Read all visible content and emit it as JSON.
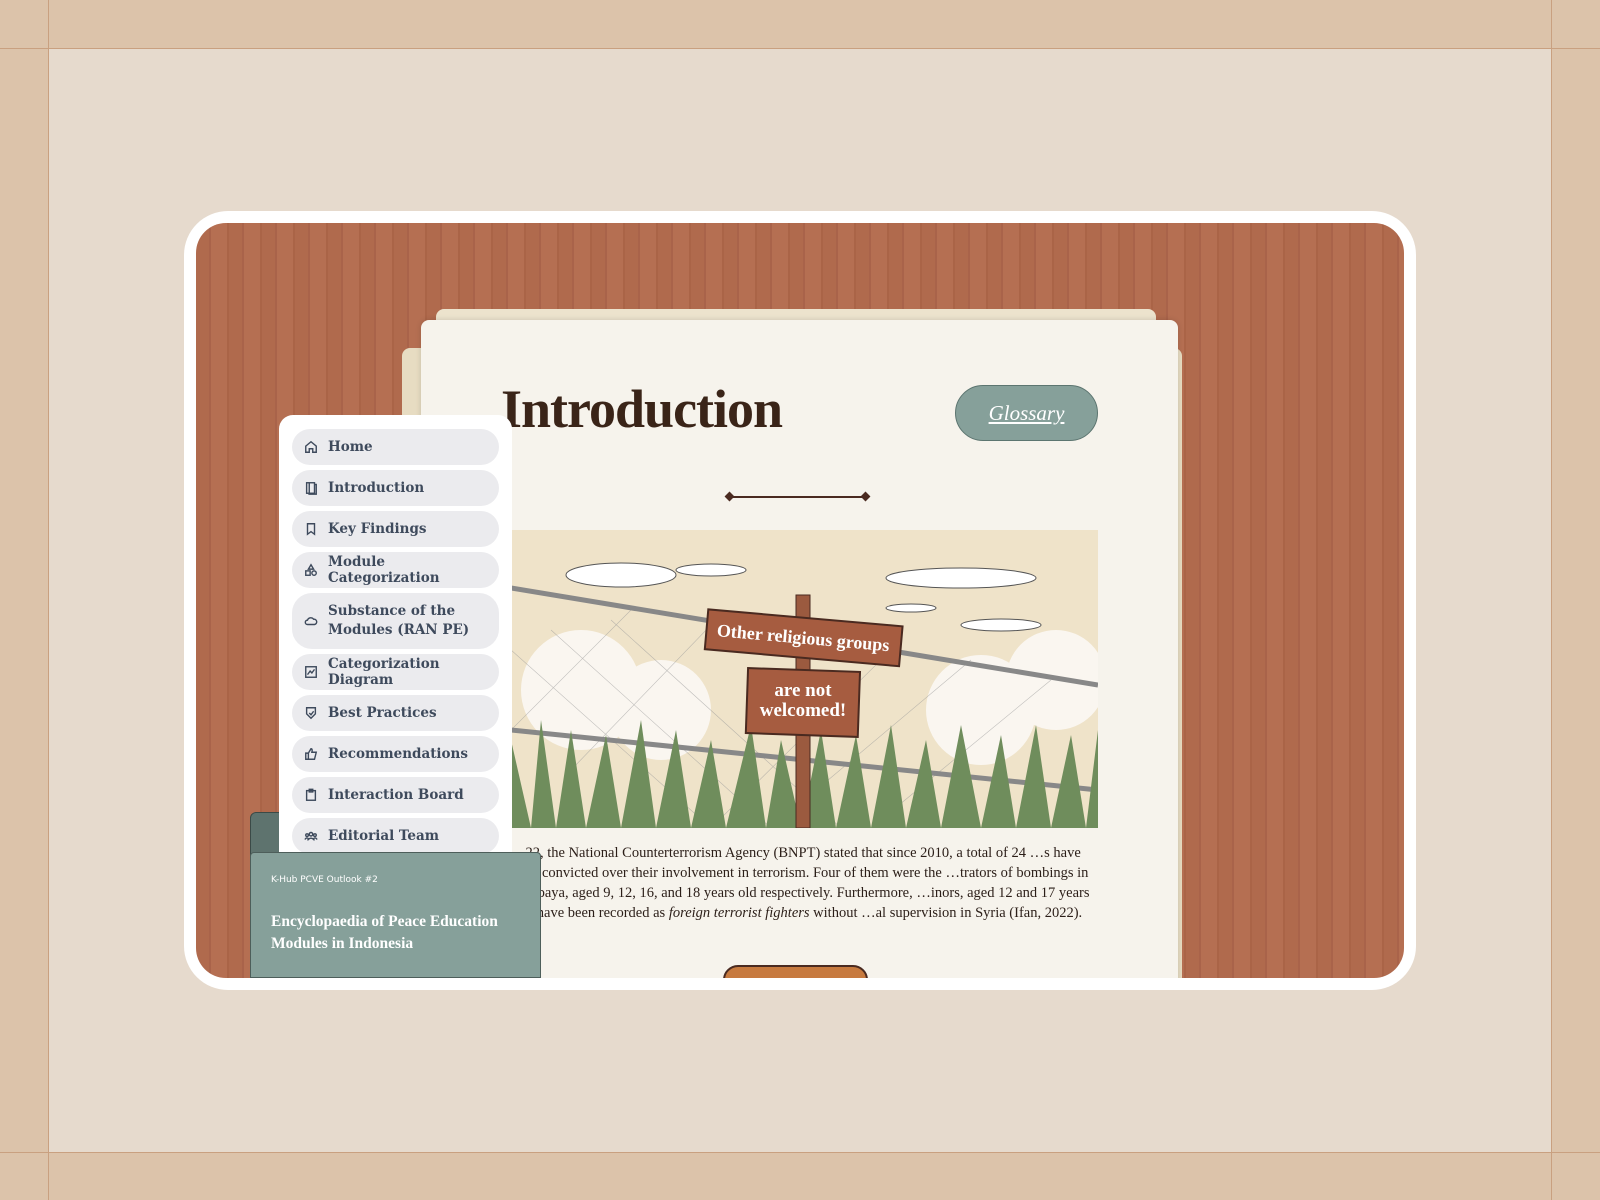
{
  "page": {
    "title": "Introduction",
    "glossary_label": "Glossary"
  },
  "illustration": {
    "sign_top": "Other religious groups",
    "sign_bottom_1": "are not",
    "sign_bottom_2": "welcomed!"
  },
  "paragraph": {
    "part1": "…22, the National Counterterrorism Agency (BNPT) stated that since 2010, a total of 24 …s have been convicted over their involvement in terrorism. Four of them were the …trators of bombings in Surabaya, aged 9, 12, 16, and 18 years old respectively. Furthermore, …inors, aged 12 and 17 years old, have been recorded as ",
    "italic": "foreign terrorist fighters",
    "part2": " without …al supervision in Syria (Ifan, 2022)."
  },
  "sidebar": {
    "items": [
      {
        "label": "Home",
        "icon": "home-icon"
      },
      {
        "label": "Introduction",
        "icon": "book-icon"
      },
      {
        "label": "Key Findings",
        "icon": "bookmark-icon"
      },
      {
        "label": "Module Categorization",
        "icon": "shapes-icon"
      },
      {
        "label": "Substance of the Modules (RAN PE)",
        "icon": "cloud-icon"
      },
      {
        "label": "Categorization Diagram",
        "icon": "chart-icon"
      },
      {
        "label": "Best Practices",
        "icon": "shield-check-icon"
      },
      {
        "label": "Recommendations",
        "icon": "thumbs-up-icon"
      },
      {
        "label": "Interaction Board",
        "icon": "clipboard-icon"
      },
      {
        "label": "Editorial Team",
        "icon": "users-icon"
      }
    ]
  },
  "card": {
    "subtitle": "K-Hub PCVE Outlook #2",
    "title": "Encyclopaedia of Peace Education Modules in Indonesia"
  },
  "colors": {
    "wood": "#b06a4d",
    "paper": "#f6f3ec",
    "accent": "#86a09a",
    "title": "#3a2418"
  }
}
